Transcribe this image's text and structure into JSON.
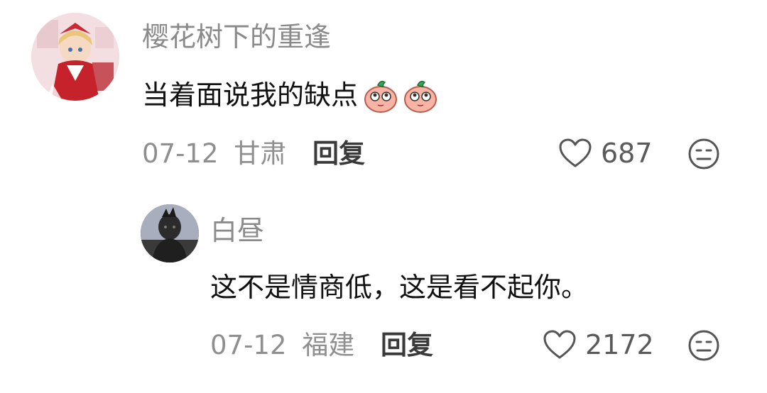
{
  "comments": [
    {
      "username": "樱花树下的重逢",
      "text": "当着面说我的缺点",
      "emojis": [
        "peach-face-emoji",
        "peach-face-emoji"
      ],
      "date": "07-12",
      "location": "甘肃",
      "reply_label": "回复",
      "likes": "687",
      "avatar": "anime-girl-red-dress"
    },
    {
      "username": "白昼",
      "text": "这不是情商低，这是看不起你。",
      "date": "07-12",
      "location": "福建",
      "reply_label": "回复",
      "likes": "2172",
      "avatar": "dark-figure-photo"
    }
  ],
  "colors": {
    "username": "#8a8a8a",
    "meta": "#8f8f8f",
    "text": "#111111",
    "background": "#ffffff"
  }
}
